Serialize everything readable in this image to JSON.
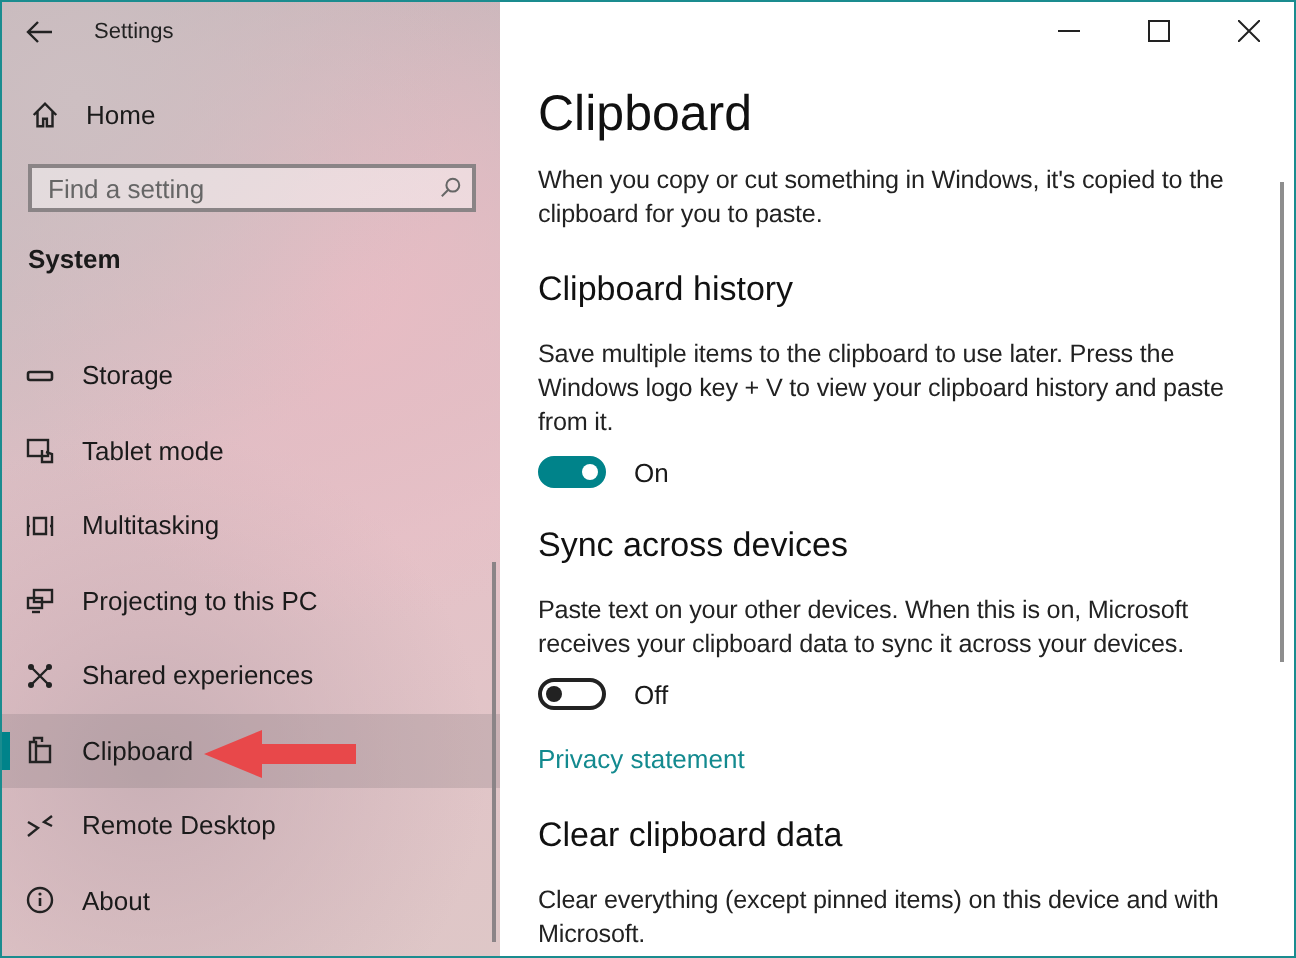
{
  "window": {
    "title": "Settings"
  },
  "sidebar": {
    "home": "Home",
    "search": {
      "placeholder": "Find a setting"
    },
    "section": "System",
    "items": [
      {
        "label": "Storage",
        "kind": "storage",
        "selected": false
      },
      {
        "label": "Tablet mode",
        "kind": "tablet",
        "selected": false
      },
      {
        "label": "Multitasking",
        "kind": "multitasking",
        "selected": false
      },
      {
        "label": "Projecting to this PC",
        "kind": "projecting",
        "selected": false
      },
      {
        "label": "Shared experiences",
        "kind": "shared",
        "selected": false
      },
      {
        "label": "Clipboard",
        "kind": "clipboard",
        "selected": true
      },
      {
        "label": "Remote Desktop",
        "kind": "remote",
        "selected": false
      },
      {
        "label": "About",
        "kind": "about",
        "selected": false
      }
    ]
  },
  "content": {
    "title": "Clipboard",
    "intro": "When you copy or cut something in Windows, it's copied to the clipboard for you to paste.",
    "sections": [
      {
        "heading": "Clipboard history",
        "text": "Save multiple items to the clipboard to use later. Press the Windows logo key + V to view your clipboard history and paste from it.",
        "toggle": {
          "on": true,
          "label": "On"
        }
      },
      {
        "heading": "Sync across devices",
        "text": "Paste text on your other devices. When this is on, Microsoft receives your clipboard data to sync it across your devices.",
        "toggle": {
          "on": false,
          "label": "Off"
        },
        "link": "Privacy statement"
      },
      {
        "heading": "Clear clipboard data",
        "text": "Clear everything (except pinned items) on this device and with Microsoft."
      }
    ]
  }
}
